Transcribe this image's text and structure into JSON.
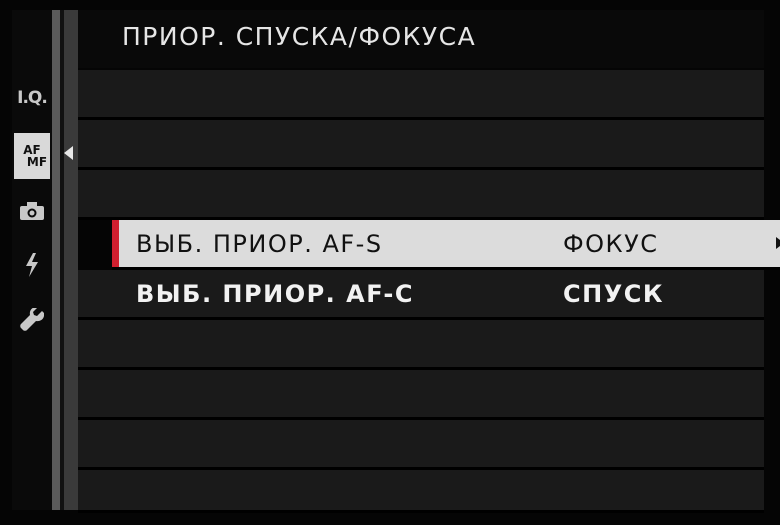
{
  "header": {
    "title": "ПРИОР. СПУСКА/ФОКУСА"
  },
  "tabs": [
    {
      "id": "iq",
      "label": "I.Q.",
      "icon": "image-quality-icon"
    },
    {
      "id": "afmf",
      "label_line1": "AF",
      "label_line2": "MF",
      "icon": "af-mf-icon",
      "active": true
    },
    {
      "id": "camera",
      "icon": "camera-icon"
    },
    {
      "id": "flash",
      "icon": "flash-icon"
    },
    {
      "id": "setup",
      "icon": "wrench-icon"
    }
  ],
  "menu": {
    "items": [
      {
        "label": "ВЫБ. ПРИОР. AF-S",
        "value": "ФОКУС",
        "selected": true
      },
      {
        "label": "ВЫБ. ПРИОР. AF-C",
        "value": "СПУСК",
        "selected": false
      }
    ]
  },
  "colors": {
    "selection_accent": "#d01f2f",
    "selected_row_bg": "#dcdcdc",
    "row_bg": "#1a1a1a"
  }
}
